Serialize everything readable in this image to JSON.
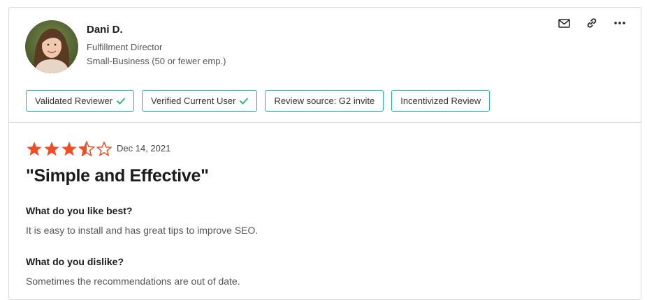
{
  "reviewer": {
    "name": "Dani D.",
    "title": "Fulfillment Director",
    "segment": "Small-Business (50 or fewer emp.)"
  },
  "actions": [
    {
      "icon": "mail-icon"
    },
    {
      "icon": "link-icon"
    },
    {
      "icon": "more-icon"
    }
  ],
  "badges": [
    {
      "label": "Validated Reviewer",
      "checked": true
    },
    {
      "label": "Verified Current User",
      "checked": true
    },
    {
      "label": "Review source: G2 invite",
      "checked": false
    },
    {
      "label": "Incentivized Review",
      "checked": false
    }
  ],
  "review": {
    "rating": 3.5,
    "rating_max": 5,
    "date": "Dec 14, 2021",
    "title": "\"Simple and Effective\"",
    "sections": [
      {
        "question": "What do you like best?",
        "answer": "It is easy to install and has great tips to improve SEO."
      },
      {
        "question": "What do you dislike?",
        "answer": "Sometimes the recommendations are out of date."
      }
    ]
  },
  "colors": {
    "star": "#f04d24",
    "badge_border": "#1bb6a6",
    "check": "#27b88a",
    "divider": "#d9d9d9"
  }
}
